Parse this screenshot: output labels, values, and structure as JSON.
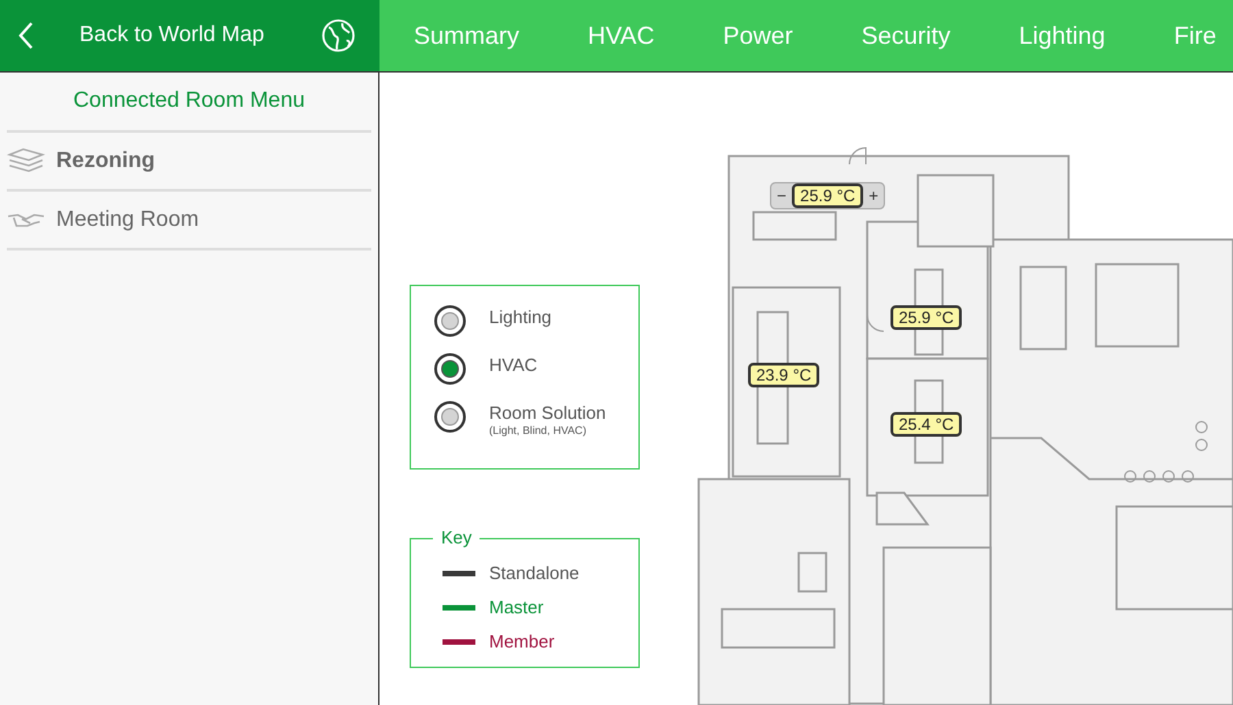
{
  "header": {
    "back_label": "Back to World Map",
    "tabs": [
      {
        "label": "Summary",
        "selected": false
      },
      {
        "label": "HVAC",
        "selected": false
      },
      {
        "label": "Power",
        "selected": false
      },
      {
        "label": "Security",
        "selected": false
      },
      {
        "label": "Lighting",
        "selected": false
      },
      {
        "label": "Fire",
        "selected": false
      }
    ]
  },
  "sidebar": {
    "title": "Connected Room Menu",
    "items": [
      {
        "label": "Rezoning",
        "kind": "layers",
        "selected": true
      },
      {
        "label": "Meeting Room",
        "kind": "handshake",
        "selected": false
      }
    ]
  },
  "mode_panel": {
    "options": [
      {
        "label": "Lighting",
        "selected": false
      },
      {
        "label": "HVAC",
        "selected": true
      },
      {
        "label": "Room Solution",
        "note": "(Light, Blind, HVAC)",
        "selected": false
      }
    ]
  },
  "key": {
    "title": "Key",
    "items": [
      {
        "label": "Standalone",
        "color": "#3a3a3a"
      },
      {
        "label": "Master",
        "color": "#0a9339"
      },
      {
        "label": "Member",
        "color": "#a0123f"
      }
    ]
  },
  "floor_plan": {
    "readings": [
      {
        "value": "25.9 °C",
        "minus": "−",
        "plus": "+"
      },
      {
        "value": "25.9 °C"
      },
      {
        "value": "23.9 °C"
      },
      {
        "value": "25.4 °C"
      }
    ]
  }
}
